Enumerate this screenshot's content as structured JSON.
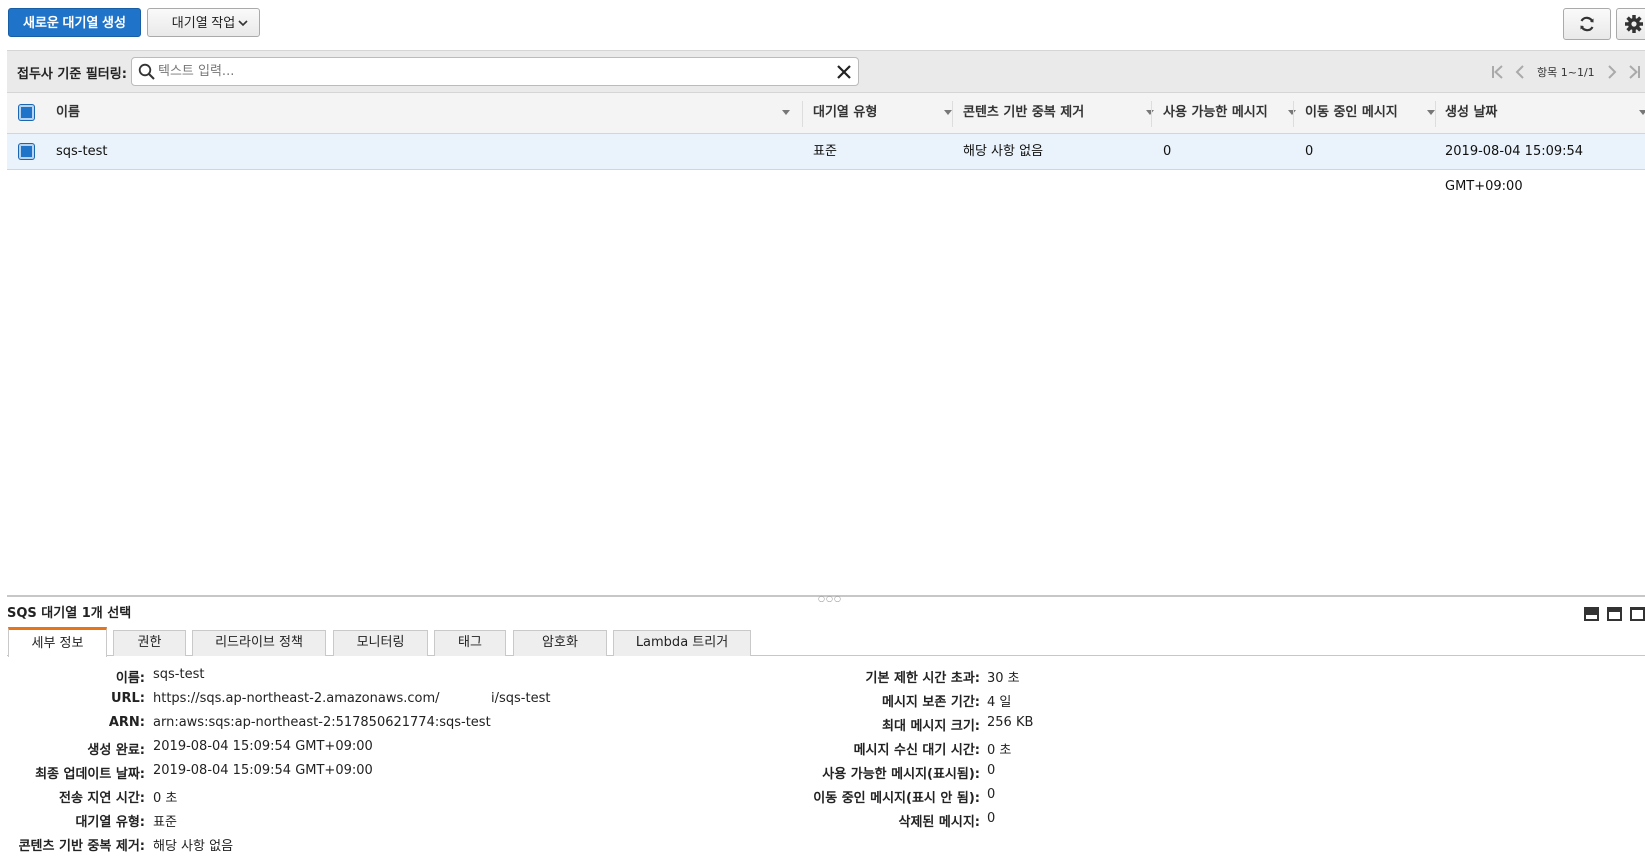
{
  "toolbar": {
    "create_label": "새로운 대기열 생성",
    "actions_label": "대기열 작업",
    "refresh_icon": "refresh-icon",
    "settings_icon": "gear-icon"
  },
  "filter": {
    "label": "접두사 기준 필터링:",
    "placeholder": "텍스트 입력...",
    "pager_text": "항목 1~1/1"
  },
  "table": {
    "headers": [
      "이름",
      "대기열 유형",
      "콘텐츠 기반 중복 제거",
      "사용 가능한 메시지",
      "이동 중인 메시지",
      "생성 날짜"
    ],
    "rows": [
      {
        "name": "sqs-test",
        "type": "표준",
        "dedup": "해당 사항 없음",
        "available": "0",
        "in_flight": "0",
        "created": "2019-08-04 15:09:54 GMT+09:00"
      }
    ]
  },
  "panel": {
    "title": "SQS 대기열 1개 선택",
    "tabs": [
      "세부 정보",
      "권한",
      "리드라이브 정책",
      "모니터링",
      "태그",
      "암호화",
      "Lambda 트리거"
    ],
    "details_left": [
      {
        "label": "이름:",
        "value": "sqs-test"
      },
      {
        "label": "URL:",
        "value": "https://sqs.ap-northeast-2.amazonaws.com/"
      },
      {
        "label": "ARN:",
        "value": "arn:aws:sqs:ap-northeast-2:517850621774:sqs-test"
      },
      {
        "label": "생성 완료:",
        "value": "2019-08-04 15:09:54 GMT+09:00"
      },
      {
        "label": "최종 업데이트 날짜:",
        "value": "2019-08-04 15:09:54 GMT+09:00"
      },
      {
        "label": "전송 지연 시간:",
        "value": "0 초"
      },
      {
        "label": "대기열 유형:",
        "value": "표준"
      },
      {
        "label": "콘텐츠 기반 중복 제거:",
        "value": "해당 사항 없음"
      }
    ],
    "url_suffix": "i/sqs-test",
    "details_right": [
      {
        "label": "기본 제한 시간 초과:",
        "value": "30 초"
      },
      {
        "label": "메시지 보존 기간:",
        "value": "4 일"
      },
      {
        "label": "최대 메시지 크기:",
        "value": "256 KB"
      },
      {
        "label": "메시지 수신 대기 시간:",
        "value": "0 초"
      },
      {
        "label": "사용 가능한 메시지(표시됨):",
        "value": "0"
      },
      {
        "label": "이동 중인 메시지(표시 안 됨):",
        "value": "0"
      },
      {
        "label": "삭제된 메시지:",
        "value": "0"
      }
    ]
  },
  "colors": {
    "primary": "#1f73c8",
    "active_tab_accent": "#e8741a",
    "selected_row": "#eaf3fb"
  }
}
